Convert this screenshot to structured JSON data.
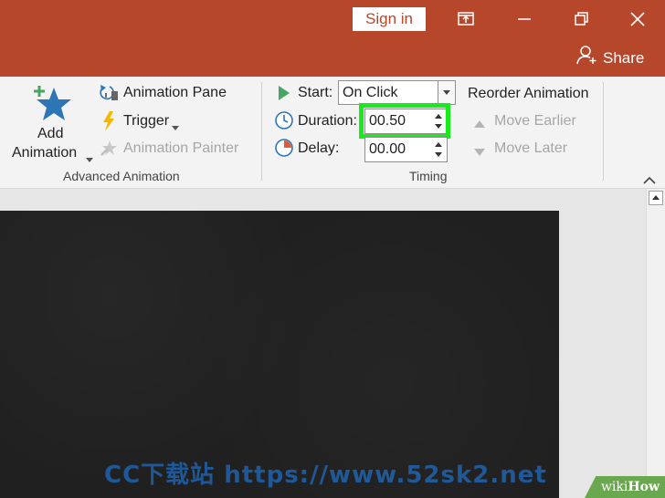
{
  "titlebar": {
    "sign_in": "Sign in",
    "share": "Share",
    "controls": [
      "ribbon-display-options-icon",
      "minimize-icon",
      "restore-icon",
      "close-icon"
    ]
  },
  "advanced_animation": {
    "add_animation_line1": "Add",
    "add_animation_line2": "Animation",
    "animation_pane": "Animation Pane",
    "trigger": "Trigger",
    "animation_painter": "Animation Painter",
    "group_label": "Advanced Animation"
  },
  "timing": {
    "start_label": "Start:",
    "start_value": "On Click",
    "duration_label": "Duration:",
    "duration_value": "00.50",
    "delay_label": "Delay:",
    "delay_value": "00.00",
    "group_label": "Timing"
  },
  "reorder": {
    "title": "Reorder Animation",
    "move_earlier": "Move Earlier",
    "move_later": "Move Later"
  },
  "watermark": "CC下载站 https://www.52sk2.net",
  "badge": {
    "wiki": "wiki",
    "how": "How"
  },
  "colors": {
    "titlebar": "#b7472a",
    "highlight": "#19ea1c",
    "accent_blue": "#2e75b6",
    "animation_green": "#4aa564"
  }
}
